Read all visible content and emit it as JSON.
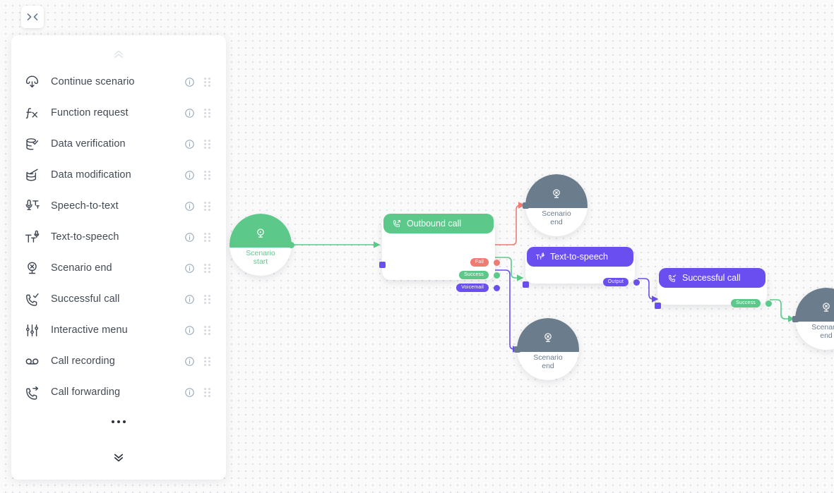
{
  "toolbar": {
    "collapse_button_icon": "collapse-horizontal-icon",
    "collapse_button_label": "><"
  },
  "sidebar": {
    "scroll_up_icon": "chevron-double-up-icon",
    "scroll_down_icon": "chevron-double-down-icon",
    "more_icon": "ellipsis-icon",
    "info_icon": "info-circle-icon",
    "drag_icon": "drag-handle-icon",
    "items": [
      {
        "label": "Continue scenario",
        "icon": "continue-scenario-icon"
      },
      {
        "label": "Function request",
        "icon": "function-request-icon"
      },
      {
        "label": "Data verification",
        "icon": "data-verification-icon"
      },
      {
        "label": "Data modification",
        "icon": "data-modification-icon"
      },
      {
        "label": "Speech-to-text",
        "icon": "speech-to-text-icon"
      },
      {
        "label": "Text-to-speech",
        "icon": "text-to-speech-icon"
      },
      {
        "label": "Scenario end",
        "icon": "scenario-end-icon"
      },
      {
        "label": "Successful call",
        "icon": "successful-call-icon"
      },
      {
        "label": "Interactive menu",
        "icon": "interactive-menu-icon"
      },
      {
        "label": "Call recording",
        "icon": "call-recording-icon"
      },
      {
        "label": "Call forwarding",
        "icon": "call-forwarding-icon"
      }
    ]
  },
  "colors": {
    "green": "#5cc98a",
    "green_dark": "#4cbd7b",
    "purple": "#6b4ef0",
    "purple_light": "#7b5cf5",
    "red": "#ef7b72",
    "slate": "#6b7c8c",
    "canvas_bg": "#fafafa",
    "dot": "#d4d6dd"
  },
  "flow": {
    "nodes": [
      {
        "id": "scenario-start",
        "type": "terminal",
        "label": "Scenario start",
        "label_line1": "Scenario",
        "label_line2": "start",
        "icon": "play-scenario-icon",
        "accent": "#5cc98a"
      },
      {
        "id": "outbound-call",
        "type": "action",
        "title": "Outbound call",
        "icon": "outbound-call-icon",
        "accent": "#5cc98a",
        "ports": [
          {
            "label": "Fail",
            "color": "#ef7b72"
          },
          {
            "label": "Success",
            "color": "#5cc98a"
          },
          {
            "label": "Voicemail",
            "color": "#6b4ef0"
          }
        ]
      },
      {
        "id": "scenario-end-top",
        "type": "terminal",
        "label": "Scenario end",
        "label_line1": "Scenario",
        "label_line2": "end",
        "icon": "scenario-end-icon",
        "accent": "#6b7c8c"
      },
      {
        "id": "scenario-end-bottom",
        "type": "terminal",
        "label": "Scenario end",
        "label_line1": "Scenario",
        "label_line2": "end",
        "icon": "scenario-end-icon",
        "accent": "#6b7c8c"
      },
      {
        "id": "text-to-speech",
        "type": "action",
        "title": "Text-to-speech",
        "icon": "text-to-speech-icon",
        "accent": "#6b4ef0",
        "ports": [
          {
            "label": "Output",
            "color": "#6b4ef0"
          }
        ]
      },
      {
        "id": "successful-call",
        "type": "action",
        "title": "Successful call",
        "icon": "successful-call-icon",
        "accent": "#6b4ef0",
        "ports": [
          {
            "label": "Success",
            "color": "#5cc98a"
          }
        ]
      },
      {
        "id": "scenario-end-right",
        "type": "terminal",
        "label": "Scenario end",
        "label_line1": "Scenario",
        "label_line2": "end",
        "icon": "scenario-end-icon",
        "accent": "#6b7c8c"
      }
    ],
    "edges": [
      {
        "from": "scenario-start",
        "to": "outbound-call",
        "color": "#5cc98a"
      },
      {
        "from": "outbound-call:Fail",
        "to": "scenario-end-top",
        "color": "#ef7b72"
      },
      {
        "from": "outbound-call:Success",
        "to": "text-to-speech",
        "color": "#5cc98a"
      },
      {
        "from": "outbound-call:Voicemail",
        "to": "scenario-end-bottom",
        "color": "#6b4ef0"
      },
      {
        "from": "text-to-speech:Output",
        "to": "successful-call",
        "color": "#6b4ef0"
      },
      {
        "from": "successful-call:Success",
        "to": "scenario-end-right",
        "color": "#5cc98a"
      }
    ]
  }
}
